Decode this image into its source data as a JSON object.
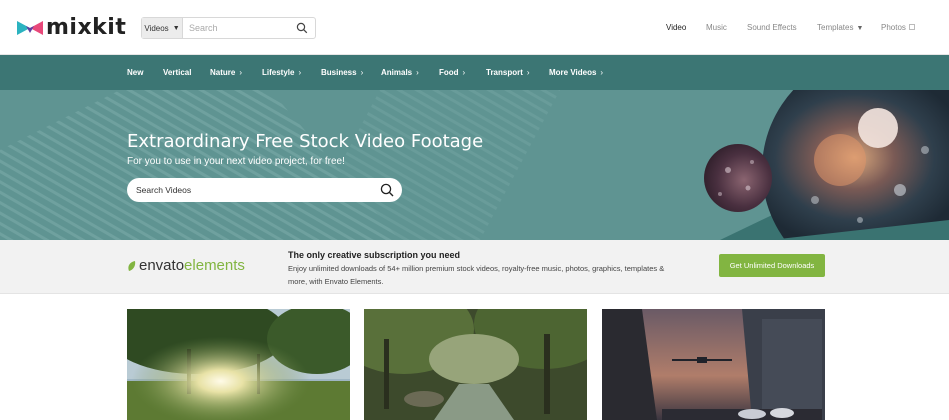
{
  "brand": {
    "name": "mixkit"
  },
  "header": {
    "search_type": "Videos",
    "search_placeholder": "Search",
    "nav": {
      "video": "Video",
      "music": "Music",
      "sound_effects": "Sound Effects",
      "templates": "Templates",
      "photos": "Photos"
    }
  },
  "categories": [
    "New",
    "Vertical",
    "Nature",
    "Lifestyle",
    "Business",
    "Animals",
    "Food",
    "Transport",
    "More Videos"
  ],
  "hero": {
    "title": "Extraordinary Free Stock Video Footage",
    "subtitle": "For you to use in your next video project, for free!",
    "search_placeholder": "Search Videos"
  },
  "envato": {
    "logo_word1": "envato",
    "logo_word2": "elements",
    "headline": "The only creative subscription you need",
    "body": "Enjoy unlimited downloads of 54+ million premium stock videos, royalty-free music, photos, graphics, templates & more, with Envato Elements.",
    "cta": "Get Unlimited Downloads"
  },
  "colors": {
    "teal_nav": "#3c7674",
    "hero_teal": "#5f9492",
    "envato_green": "#82b541"
  },
  "icons": [
    "search-icon",
    "external-link-icon",
    "chevron-right-icon",
    "caret-down-icon",
    "envato-leaf-icon"
  ]
}
